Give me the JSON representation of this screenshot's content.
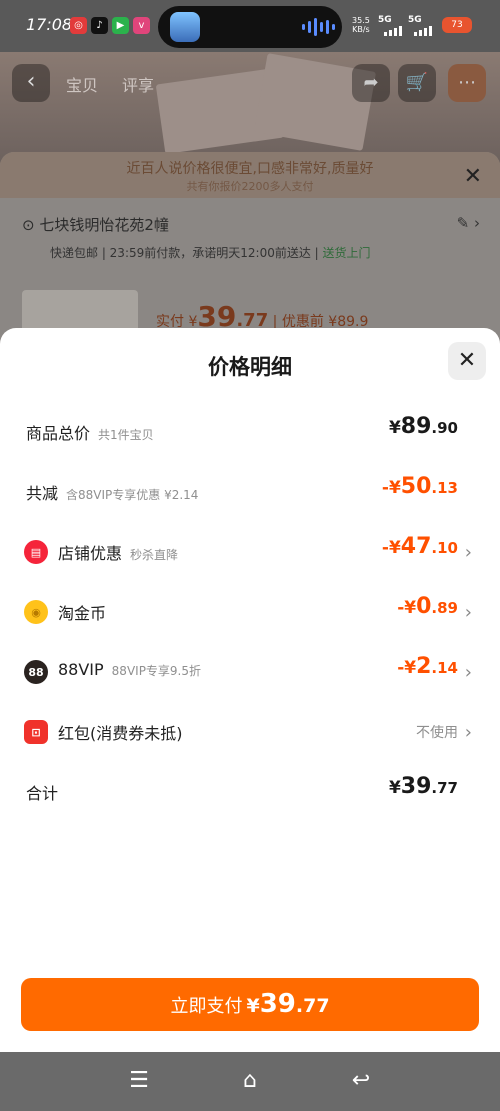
{
  "status_bar": {
    "time": "17:08",
    "speed_value": "35.5",
    "speed_unit": "KB/s",
    "sim1": "5G",
    "sim2": "5G",
    "battery_label": "73"
  },
  "background": {
    "tabs": [
      "宝贝",
      "评享"
    ],
    "banner": "近百人说价格很便宜,口感非常好,质量好",
    "banner_sub": "共有你报价2200多人支付",
    "address": "七块钱明怡花苑2幢",
    "shipping": "快递包邮 | 23:59前付款，承诺明天12:00前送达 | ",
    "shipping_highlight": "送货上门",
    "price_prefix": "实付 ¥",
    "price_int": "39",
    "price_dec": ".77",
    "price_before": " | 优惠前 ¥89.9"
  },
  "sheet": {
    "title": "价格明细",
    "rows": [
      {
        "label": "商品总价",
        "sub": "共1件宝贝",
        "cur": "¥",
        "int": "89",
        "dec": ".90"
      },
      {
        "label": "共减",
        "sub": "含88VIP专享优惠 ¥2.14",
        "cur": "-¥",
        "int": "50",
        "dec": ".13"
      },
      {
        "label": "店铺优惠",
        "sub": "秒杀直降",
        "cur": "-¥",
        "int": "47",
        "dec": ".10",
        "icon": "shop-coupon-icon"
      },
      {
        "label": "淘金币",
        "sub": "",
        "cur": "-¥",
        "int": "0",
        "dec": ".89",
        "icon": "gold-coin-icon"
      },
      {
        "label": "88VIP",
        "sub": "88VIP专享9.5折",
        "cur": "-¥",
        "int": "2",
        "dec": ".14",
        "icon": "vip88-icon",
        "icon_text": "88"
      },
      {
        "label": "红包(消费券未抵)",
        "sub": "",
        "value_text": "不使用",
        "icon": "red-packet-icon"
      },
      {
        "label": "合计",
        "sub": "",
        "cur": "¥",
        "int": "39",
        "dec": ".77"
      }
    ],
    "pay_button": {
      "label": "立即支付",
      "cur": "¥",
      "int": "39",
      "dec": ".77"
    }
  },
  "colors": {
    "accent": "#ff5000",
    "pay_button": "#ff6a00",
    "shop_icon": "#f5243a",
    "coin_icon": "#ffc21a",
    "vip_icon": "#2a2320",
    "red_packet": "#f0322b"
  },
  "nav_bar": {
    "icons": [
      "menu-icon",
      "home-icon",
      "back-icon"
    ]
  }
}
